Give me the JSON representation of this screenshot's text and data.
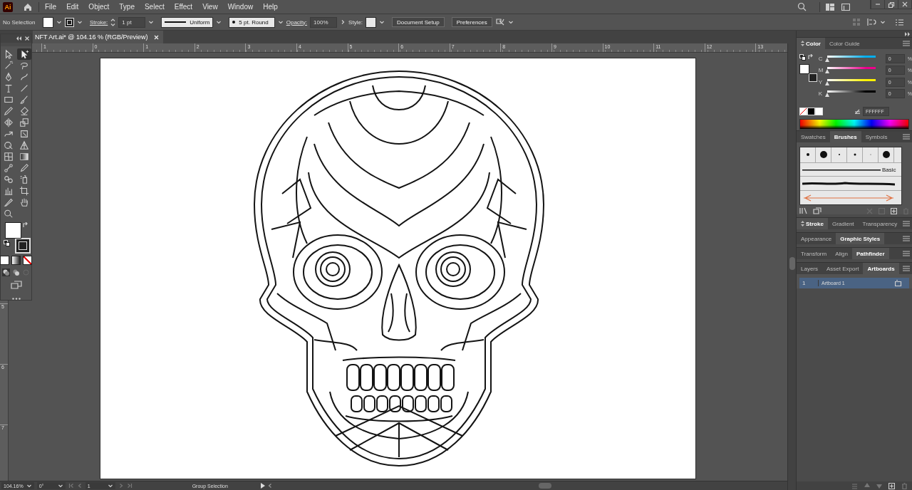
{
  "menu_bar": {
    "logo": "Ai",
    "menus": [
      "File",
      "Edit",
      "Object",
      "Type",
      "Select",
      "Effect",
      "View",
      "Window",
      "Help"
    ]
  },
  "control_bar": {
    "selection": "No Selection",
    "stroke_label": "Stroke:",
    "stroke_weight": "1 pt",
    "stroke_profile": "Uniform",
    "brush": "5 pt. Round",
    "opacity_label": "Opacity:",
    "opacity": "100%",
    "style_label": "Style:",
    "buttons": [
      "Document Setup",
      "Preferences"
    ]
  },
  "document_tab": {
    "title": "NFT Art.ai* @ 104.16 % (RGB/Preview)"
  },
  "rulers": {
    "horizontal": [
      "1",
      "0",
      "1",
      "2",
      "3",
      "4",
      "5",
      "6",
      "7",
      "8",
      "9",
      "10",
      "11",
      "12",
      "13"
    ],
    "vertical": [
      "5",
      "6",
      "7"
    ]
  },
  "tools": [
    {
      "kind": "selection",
      "selected": false
    },
    {
      "kind": "direct-selection",
      "selected": true
    },
    {
      "kind": "magic-wand",
      "selected": false
    },
    {
      "kind": "lasso",
      "selected": false
    },
    {
      "kind": "pen",
      "selected": false
    },
    {
      "kind": "curvature",
      "selected": false
    },
    {
      "kind": "type",
      "selected": false
    },
    {
      "kind": "line",
      "selected": false
    },
    {
      "kind": "rectangle",
      "selected": false
    },
    {
      "kind": "paintbrush",
      "selected": false
    },
    {
      "kind": "pencil",
      "selected": false
    },
    {
      "kind": "eraser",
      "selected": false
    },
    {
      "kind": "reflect",
      "selected": false
    },
    {
      "kind": "scale",
      "selected": false
    },
    {
      "kind": "warp",
      "selected": false
    },
    {
      "kind": "free-transform",
      "selected": false
    },
    {
      "kind": "shape-builder",
      "selected": false
    },
    {
      "kind": "perspective-grid",
      "selected": false
    },
    {
      "kind": "mesh",
      "selected": false
    },
    {
      "kind": "gradient",
      "selected": false
    },
    {
      "kind": "blend",
      "selected": false
    },
    {
      "kind": "eyedropper",
      "selected": false
    },
    {
      "kind": "symbol-sprayer",
      "selected": false
    },
    {
      "kind": "spray",
      "selected": false
    },
    {
      "kind": "graph",
      "selected": false
    },
    {
      "kind": "artboard",
      "selected": false
    },
    {
      "kind": "slice",
      "selected": false
    },
    {
      "kind": "hand",
      "selected": false
    },
    {
      "kind": "zoom",
      "selected": false
    }
  ],
  "color_panel": {
    "tabs": [
      {
        "label": "Color",
        "selected": true
      },
      {
        "label": "Color Guide",
        "selected": false
      }
    ],
    "channels": [
      {
        "name": "C",
        "color": "#00aeef",
        "level": 0,
        "value": "0",
        "unit": "%"
      },
      {
        "name": "M",
        "color": "#ec008c",
        "level": 0,
        "value": "0",
        "unit": "%"
      },
      {
        "name": "Y",
        "color": "#fff200",
        "level": 0,
        "value": "0",
        "unit": "%"
      },
      {
        "name": "K",
        "color": "#000000",
        "level": 0,
        "value": "0",
        "unit": "%"
      }
    ],
    "hex": "FFFFFF"
  },
  "brushes_panel": {
    "tabs": [
      {
        "label": "Swatches",
        "selected": false
      },
      {
        "label": "Brushes",
        "selected": true
      },
      {
        "label": "Symbols",
        "selected": false
      }
    ],
    "basic_label": "Basic"
  },
  "panel_groups": [
    {
      "tabs": [
        {
          "label": "Stroke",
          "selected": true
        },
        {
          "label": "Gradient",
          "selected": false
        },
        {
          "label": "Transparency",
          "selected": false
        }
      ]
    },
    {
      "tabs": [
        {
          "label": "Appearance",
          "selected": false
        },
        {
          "label": "Graphic Styles",
          "selected": true
        }
      ]
    },
    {
      "tabs": [
        {
          "label": "Transform",
          "selected": false
        },
        {
          "label": "Align",
          "selected": false
        },
        {
          "label": "Pathfinder",
          "selected": true
        }
      ]
    },
    {
      "tabs": [
        {
          "label": "Layers",
          "selected": false
        },
        {
          "label": "Asset Export",
          "selected": false
        },
        {
          "label": "Artboards",
          "selected": true
        }
      ]
    }
  ],
  "artboards": [
    {
      "number": "1",
      "name": "Artboard 1",
      "selected": true
    }
  ],
  "status_bar": {
    "zoom": "104.16%",
    "rotation": "0°",
    "artboard": "1",
    "tool": "Group Selection"
  }
}
